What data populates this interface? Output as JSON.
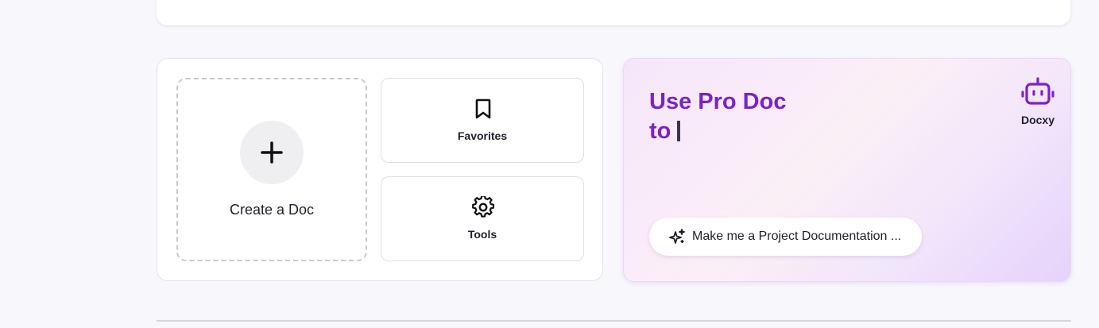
{
  "actions": {
    "create_label": "Create a Doc",
    "favorites_label": "Favorites",
    "tools_label": "Tools"
  },
  "pro": {
    "title_line1": "Use Pro Doc",
    "title_line2": "to",
    "assistant_label": "Docxy",
    "prompt_text": "Make me a Project Documentation ..."
  },
  "colors": {
    "accent": "#7b22c9",
    "page_bg": "#f8f7fc"
  }
}
